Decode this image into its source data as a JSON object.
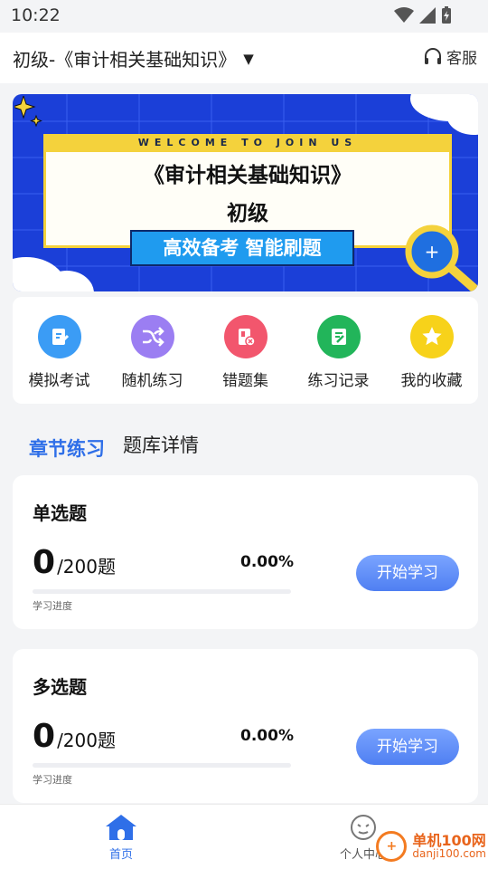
{
  "status_bar": {
    "time": "10:22"
  },
  "header": {
    "subject_title": "初级-《审计相关基础知识》",
    "service_label": "客服"
  },
  "banner": {
    "welcome": "WELCOME TO JOIN US",
    "title": "《审计相关基础知识》",
    "level": "初级",
    "slogan": "高效备考 智能刷题"
  },
  "quick_actions": [
    {
      "label": "模拟考试",
      "icon": "exam-icon",
      "color": "#3b9cf5"
    },
    {
      "label": "随机练习",
      "icon": "shuffle-icon",
      "color": "#9b7ef2"
    },
    {
      "label": "错题集",
      "icon": "wrong-questions-icon",
      "color": "#f2566d"
    },
    {
      "label": "练习记录",
      "icon": "record-icon",
      "color": "#22b55a"
    },
    {
      "label": "我的收藏",
      "icon": "star-icon",
      "color": "#f7d21a"
    }
  ],
  "tabs": {
    "active": "章节练习",
    "other": "题库详情"
  },
  "cards": [
    {
      "title": "单选题",
      "done": "0",
      "total": "/200题",
      "percent": "0.00%",
      "progress": 0,
      "progress_label": "学习进度",
      "button": "开始学习"
    },
    {
      "title": "多选题",
      "done": "0",
      "total": "/200题",
      "percent": "0.00%",
      "progress": 0,
      "progress_label": "学习进度",
      "button": "开始学习"
    }
  ],
  "bottom_nav": {
    "home": {
      "label": "首页",
      "color": "#2f6fe8"
    },
    "profile": {
      "label": "个人中心"
    }
  },
  "watermark": {
    "name": "单机100网",
    "url": "danji100.com"
  }
}
